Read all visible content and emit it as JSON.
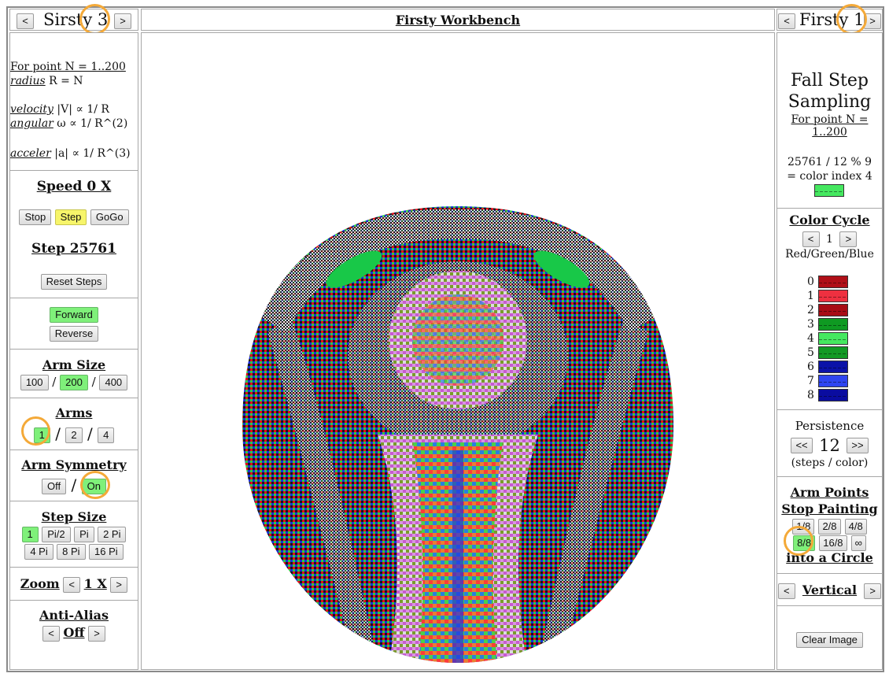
{
  "header": {
    "left_title": "Sirsty 3",
    "center_title": "Firsty Workbench",
    "right_title": "Firsty 1",
    "prev_symbol": "<",
    "next_symbol": ">"
  },
  "left": {
    "formula": {
      "line1": "For point N = 1..200",
      "radius_word": "radius",
      "radius_rest": " R = N",
      "velocity_word": "velocity",
      "velocity_rest": " |V| ∝ 1/ R",
      "angular_word": "angular",
      "angular_rest": " ω ∝ 1/ R^(2)",
      "acceler_word": "acceler",
      "acceler_rest": " |a| ∝ 1/ R^(3)"
    },
    "speed_label": "Speed 0 X",
    "stop": "Stop",
    "step": "Step",
    "gogo": "GoGo",
    "step_count": "Step 25761",
    "reset_steps": "Reset Steps",
    "forward": "Forward",
    "reverse": "Reverse",
    "arm_size_label": "Arm Size",
    "arm_size": [
      "100",
      "200",
      "400"
    ],
    "arms_label": "Arms",
    "arms": [
      "1",
      "2",
      "4"
    ],
    "arm_symmetry_label": "Arm Symmetry",
    "symmetry_off": "Off",
    "symmetry_on": "On",
    "slash": "/",
    "step_size_label": "Step Size",
    "step_sizes_row1": [
      "1",
      "Pi/2",
      "Pi",
      "2 Pi"
    ],
    "step_sizes_row2": [
      "4 Pi",
      "8 Pi",
      "16 Pi"
    ],
    "zoom_label": "Zoom",
    "zoom_value": "1 X",
    "anti_alias_label": "Anti-Alias",
    "anti_alias_value": "Off"
  },
  "right": {
    "title_line1": "Fall Step",
    "title_line2": "Sampling",
    "subtitle": "For point N = 1..200",
    "calc_line1": "25761 / 12 % 9",
    "calc_line2": "= color index 4",
    "color_cycle_label": "Color Cycle",
    "color_cycle_value": "1",
    "color_cycle_name": "Red/Green/Blue",
    "legend": [
      {
        "index": "0",
        "color": "#b01018"
      },
      {
        "index": "1",
        "color": "#ee3040"
      },
      {
        "index": "2",
        "color": "#a80d15"
      },
      {
        "index": "3",
        "color": "#0f9a22"
      },
      {
        "index": "4",
        "color": "#45e860"
      },
      {
        "index": "5",
        "color": "#129a25"
      },
      {
        "index": "6",
        "color": "#0b12a8"
      },
      {
        "index": "7",
        "color": "#2e45f0"
      },
      {
        "index": "8",
        "color": "#0a0ca0"
      }
    ],
    "persistence_label": "Persistence",
    "persistence_value": "12",
    "persistence_units": "(steps / color)",
    "dec_symbol": "<<",
    "inc_symbol": ">>",
    "arm_points_label": "Arm Points",
    "stop_painting_label": "Stop Painting",
    "fractions_row1": [
      "1/8",
      "2/8",
      "4/8"
    ],
    "fractions_row2": [
      "8/8",
      "16/8",
      "∞"
    ],
    "into_circle_label": "into a Circle",
    "orientation": "Vertical",
    "clear_image": "Clear Image"
  },
  "colors": {
    "accent_green": "#7ff07a",
    "accent_yellow": "#f7f56a",
    "highlight_ring": "#f4a938",
    "current_color_swatch": "#45e860"
  }
}
